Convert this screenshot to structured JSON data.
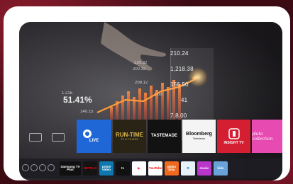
{
  "screen": {
    "overlay_values": [
      "210.24",
      "1,218.38",
      "156.50",
      "41",
      "7.8.00"
    ],
    "small_numbers": [
      "220.32",
      "200.32",
      "208.12",
      "1.00"
    ],
    "percent": "51.41%",
    "tiny_labels": [
      "1.215",
      "140.15"
    ]
  },
  "channels": {
    "live_label": "LIVE",
    "runtime": {
      "title": "RUN-TIME",
      "subtitle": "TV & FILMES"
    },
    "tastemade": "TASTEMADE",
    "bloomberg": {
      "title": "Bloomberg",
      "subtitle": "Television"
    },
    "insight": "INSIGHT TV",
    "pluto": "pluto collection"
  },
  "dock": {
    "apps": [
      {
        "label": "Samsung TV Plus",
        "color": "#101010"
      },
      {
        "label": "NETFLIX",
        "color": "#141414"
      },
      {
        "label": "prime video",
        "color": "#0f79af"
      },
      {
        "label": "tv",
        "color": "#111111"
      },
      {
        "label": "▶",
        "color": "#ffffff"
      },
      {
        "label": "YouTube",
        "color": "#ffffff"
      },
      {
        "label": "globo play",
        "color": "#f06a1d"
      },
      {
        "label": "❄",
        "color": "#e8f1f8"
      },
      {
        "label": "music",
        "color": "#b836c9"
      },
      {
        "label": "kids",
        "color": "#6aa3d9"
      }
    ]
  }
}
